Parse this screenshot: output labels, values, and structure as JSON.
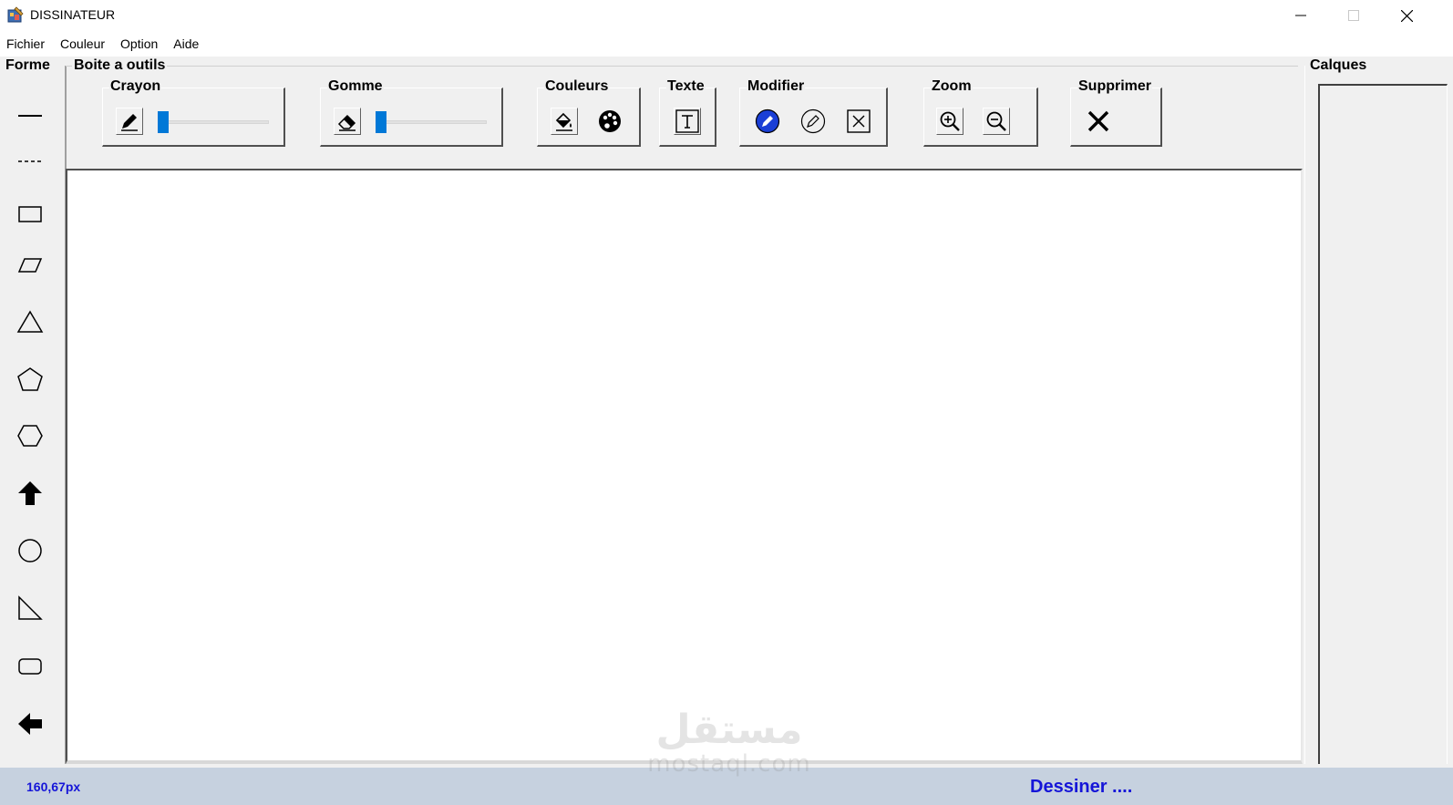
{
  "window": {
    "title": "DISSINATEUR",
    "controls": [
      "minimize",
      "maximize",
      "close"
    ]
  },
  "menu": {
    "items": [
      "Fichier",
      "Couleur",
      "Option",
      "Aide"
    ]
  },
  "forme": {
    "label": "Forme",
    "shapes": [
      {
        "icon": "line-icon"
      },
      {
        "icon": "dashed-line-icon"
      },
      {
        "icon": "rectangle-icon"
      },
      {
        "icon": "parallelogram-icon"
      },
      {
        "icon": "triangle-icon"
      },
      {
        "icon": "pentagon-icon"
      },
      {
        "icon": "hexagon-icon"
      },
      {
        "icon": "arrow-up-icon"
      },
      {
        "icon": "circle-icon"
      },
      {
        "icon": "right-triangle-icon"
      },
      {
        "icon": "rounded-rectangle-icon"
      },
      {
        "icon": "arrow-left-icon"
      }
    ]
  },
  "toolbox": {
    "label": "Boite a outils",
    "groups": {
      "crayon": {
        "label": "Crayon",
        "icon": "pencil-icon",
        "slider_value": 0
      },
      "gomme": {
        "label": "Gomme",
        "icon": "eraser-icon",
        "slider_value": 0
      },
      "couleurs": {
        "label": "Couleurs",
        "icons": [
          "paint-bucket-icon",
          "palette-icon"
        ]
      },
      "texte": {
        "label": "Texte",
        "icon": "text-icon"
      },
      "modifier": {
        "label": "Modifier",
        "icons": [
          "edit-active-icon",
          "edit-icon",
          "delete-box-icon"
        ]
      },
      "zoom": {
        "label": "Zoom",
        "icons": [
          "zoom-in-icon",
          "zoom-out-icon"
        ]
      },
      "supprimer": {
        "label": "Supprimer",
        "icon": "delete-x-icon"
      }
    }
  },
  "calques": {
    "label": "Calques"
  },
  "status": {
    "coords": "160,67px",
    "message": "Dessiner ....",
    "color": "#1515d8",
    "bar_color": "#c6d1df"
  },
  "colors": {
    "accent": "#0078d7",
    "modifier_active": "#1a3fd6"
  },
  "watermark": {
    "arabic": "مستقل",
    "latin": "mostaql.com"
  }
}
